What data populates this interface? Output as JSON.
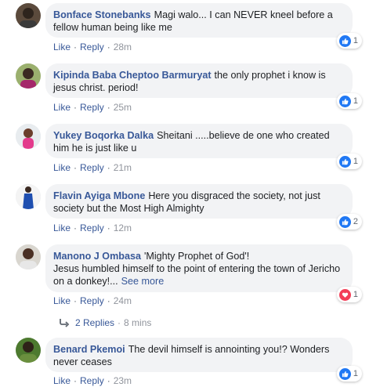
{
  "comments": [
    {
      "author": "Bonface Stonebanks",
      "text": "Magi walo... I can NEVER kneel before a fellow human being like me",
      "reaction": {
        "type": "like",
        "count": "1"
      },
      "like_label": "Like",
      "reply_label": "Reply",
      "time": "28m"
    },
    {
      "author": "Kipinda Baba Cheptoo Barmuryat",
      "text": "the only prophet i know is jesus christ. period!",
      "reaction": {
        "type": "like",
        "count": "1"
      },
      "like_label": "Like",
      "reply_label": "Reply",
      "time": "25m"
    },
    {
      "author": "Yukey Boqorka Dalka",
      "text": "Sheitani .....believe de one who created him he is just like u",
      "reaction": {
        "type": "like",
        "count": "1"
      },
      "like_label": "Like",
      "reply_label": "Reply",
      "time": "21m"
    },
    {
      "author": "Flavin Ayiga Mbone",
      "text": "Here you disgraced the society, not just society but the Most High Almighty",
      "reaction": {
        "type": "like",
        "count": "2"
      },
      "like_label": "Like",
      "reply_label": "Reply",
      "time": "12m"
    },
    {
      "author": "Manono J Ombasa",
      "text": "'Mighty Prophet of God'!",
      "text2": "Jesus humbled himself to the point of entering the town of Jericho on a donkey!...",
      "see_more": "See more",
      "reaction": {
        "type": "love",
        "count": "1"
      },
      "like_label": "Like",
      "reply_label": "Reply",
      "time": "24m",
      "replies_label": "2 Replies",
      "replies_time": "8 mins"
    },
    {
      "author": "Benard Pkemoi",
      "text": "The devil himself is annointing you!? Wonders never ceases",
      "reaction": {
        "type": "like",
        "count": "1"
      },
      "like_label": "Like",
      "reply_label": "Reply",
      "time": "23m"
    }
  ],
  "separator": "·",
  "colors": {
    "link": "#385898",
    "like": "#2078f4",
    "love": "#f33e58",
    "bubble": "#f2f3f5"
  }
}
